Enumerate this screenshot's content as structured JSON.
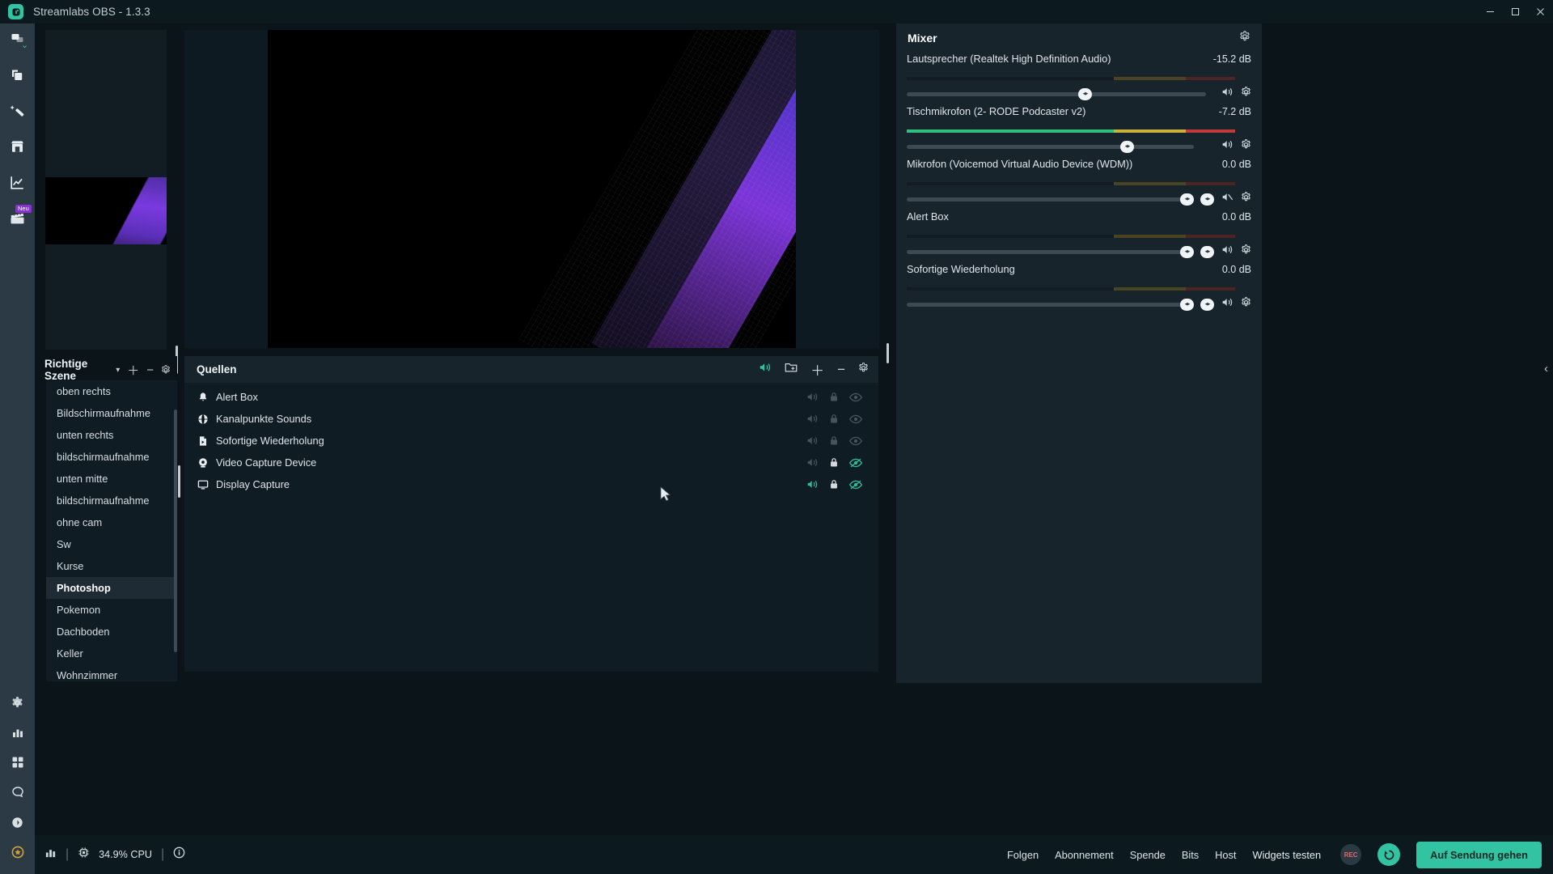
{
  "window": {
    "title": "Streamlabs OBS - 1.3.3",
    "logo_icon": "streamlabs-logo-icon",
    "minimize_label": "—",
    "maximize_label": "□",
    "close_label": "✕"
  },
  "left_nav": {
    "items": [
      {
        "name": "editor",
        "icon": "editor-layers-icon",
        "badge": ""
      },
      {
        "name": "themes",
        "icon": "copy-layers-icon",
        "badge": ""
      },
      {
        "name": "alertbox",
        "icon": "magic-wand-icon",
        "badge": ""
      },
      {
        "name": "store",
        "icon": "store-icon",
        "badge": ""
      },
      {
        "name": "dashboard",
        "icon": "analytics-chart-icon",
        "badge": ""
      },
      {
        "name": "highlighter",
        "icon": "clapperboard-icon",
        "badge": "Neu"
      }
    ],
    "bottom_items": [
      {
        "name": "prime",
        "icon": "star-badge-icon"
      },
      {
        "name": "moon",
        "icon": "moon-icon"
      },
      {
        "name": "chat",
        "icon": "chat-bubble-icon"
      },
      {
        "name": "apps",
        "icon": "grid-apps-icon"
      },
      {
        "name": "stats",
        "icon": "bar-stats-icon"
      },
      {
        "name": "help",
        "icon": "help-circle-icon"
      },
      {
        "name": "settings",
        "icon": "gear-icon"
      }
    ]
  },
  "scenes": {
    "title": "Richtige Szene",
    "header_icons": [
      {
        "name": "scene-dropdown-icon",
        "glyph": "▾"
      },
      {
        "name": "add-scene-icon",
        "glyph": "＋"
      },
      {
        "name": "remove-scene-icon",
        "glyph": "−"
      },
      {
        "name": "scene-settings-gear-icon",
        "glyph": "gear"
      }
    ],
    "items": [
      {
        "label": "oben rechts",
        "selected": false
      },
      {
        "label": "Bildschirmaufnahme",
        "selected": false
      },
      {
        "label": "unten rechts",
        "selected": false
      },
      {
        "label": "bildschirmaufnahme",
        "selected": false
      },
      {
        "label": "unten mitte",
        "selected": false
      },
      {
        "label": "bildschirmaufnahme",
        "selected": false
      },
      {
        "label": "ohne cam",
        "selected": false
      },
      {
        "label": "Sw",
        "selected": false
      },
      {
        "label": "Kurse",
        "selected": false
      },
      {
        "label": "Photoshop",
        "selected": true
      },
      {
        "label": "Pokemon",
        "selected": false
      },
      {
        "label": "Dachboden",
        "selected": false
      },
      {
        "label": "Keller",
        "selected": false
      },
      {
        "label": "Wohnzimmer",
        "selected": false
      }
    ]
  },
  "sources": {
    "title": "Quellen",
    "header_icons": [
      {
        "name": "audio-mixer-icon",
        "glyph": "audio"
      },
      {
        "name": "add-folder-icon",
        "glyph": "folder"
      },
      {
        "name": "add-source-icon",
        "glyph": "＋"
      },
      {
        "name": "remove-source-icon",
        "glyph": "−"
      },
      {
        "name": "source-settings-gear-icon",
        "glyph": "gear"
      }
    ],
    "items": [
      {
        "label": "Alert Box",
        "icon": "bell-icon",
        "locked": false,
        "visible": false,
        "audio": false
      },
      {
        "label": "Kanalpunkte Sounds",
        "icon": "globe-icon",
        "locked": false,
        "visible": false,
        "audio": false
      },
      {
        "label": "Sofortige Wiederholung",
        "icon": "media-file-icon",
        "locked": false,
        "visible": false,
        "audio": false
      },
      {
        "label": "Video Capture Device",
        "icon": "webcam-icon",
        "locked": true,
        "visible": true,
        "audio": false
      },
      {
        "label": "Display Capture",
        "icon": "monitor-icon",
        "locked": true,
        "visible": true,
        "audio": true
      }
    ],
    "row_action_icons": {
      "audio": "speaker-icon",
      "lock": "lock-icon",
      "visibility": "eye-icon"
    }
  },
  "mixer": {
    "title": "Mixer",
    "settings_icon": "gear-icon",
    "channels": [
      {
        "name": "Lautsprecher (Realtek High Definition Audio)",
        "db": "-15.2 dB",
        "meter_green_pct": 0,
        "meter_yellow_start_pct": 63,
        "meter_yellow_pct": 22,
        "meter_red_start_pct": 85,
        "meter_red_pct": 15,
        "meter_active": false,
        "slider_pct": 60,
        "muted": false,
        "has_mute_toggle": false
      },
      {
        "name": "Tischmikrofon (2- RODE Podcaster v2)",
        "db": "-7.2 dB",
        "meter_green_pct": 63,
        "meter_yellow_start_pct": 63,
        "meter_yellow_pct": 22,
        "meter_red_start_pct": 85,
        "meter_red_pct": 15,
        "meter_active": true,
        "slider_pct": 78,
        "muted": false,
        "has_mute_toggle": false
      },
      {
        "name": "Mikrofon (Voicemod Virtual Audio Device (WDM))",
        "db": "0.0 dB",
        "meter_green_pct": 0,
        "meter_yellow_start_pct": 63,
        "meter_yellow_pct": 22,
        "meter_red_start_pct": 85,
        "meter_red_pct": 15,
        "meter_active": false,
        "slider_pct": 100,
        "muted": true,
        "has_mute_toggle": true
      },
      {
        "name": "Alert Box",
        "db": "0.0 dB",
        "meter_green_pct": 0,
        "meter_yellow_start_pct": 63,
        "meter_yellow_pct": 22,
        "meter_red_start_pct": 85,
        "meter_red_pct": 15,
        "meter_active": false,
        "slider_pct": 100,
        "muted": false,
        "has_mute_toggle": true
      },
      {
        "name": "Sofortige Wiederholung",
        "db": "0.0 dB",
        "meter_green_pct": 0,
        "meter_yellow_start_pct": 63,
        "meter_yellow_pct": 22,
        "meter_red_start_pct": 85,
        "meter_red_pct": 15,
        "meter_active": false,
        "slider_pct": 100,
        "muted": false,
        "has_mute_toggle": true
      }
    ]
  },
  "collapse_arrow": "‹",
  "status_bar": {
    "stats_icon": "bar-stats-icon",
    "cpu_icon": "cpu-chip-icon",
    "cpu_text": "34.9% CPU",
    "info_icon": "info-circle-icon",
    "separator": "|",
    "links": [
      "Folgen",
      "Abonnement",
      "Spende",
      "Bits",
      "Host"
    ],
    "widgets_label": "Widgets testen",
    "record_label": "REC",
    "replay_icon": "replay-icon",
    "go_live_label": "Auf Sendung gehen"
  },
  "colors": {
    "accent_green": "#31c3a2",
    "panel_bg": "#17242c",
    "app_bg": "#0b1419",
    "nav_bg": "#2b3a45",
    "badge_purple": "#8b2fd6"
  }
}
